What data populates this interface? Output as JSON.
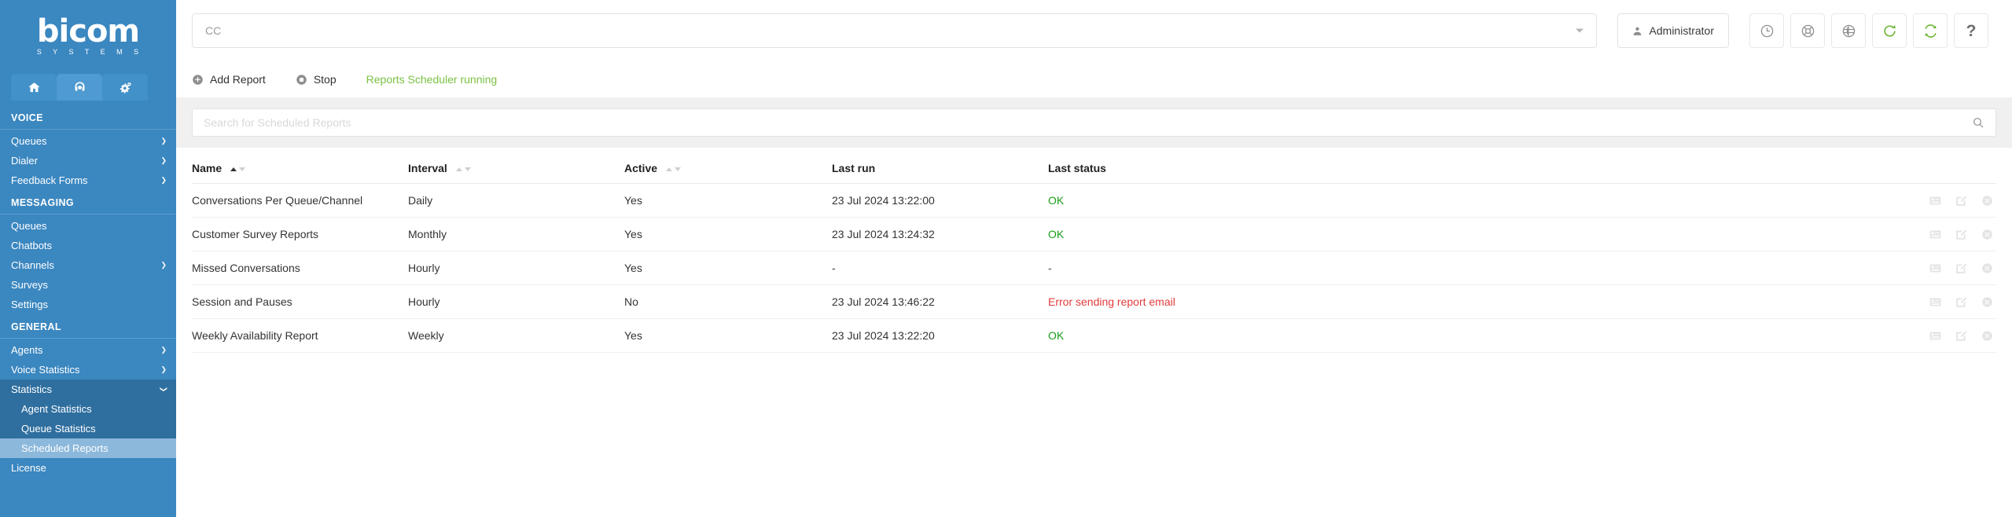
{
  "brand": {
    "name": "bicom",
    "tagline": "S Y S T E M S"
  },
  "tabs": [
    {
      "name": "home-tab",
      "icon": "home-icon",
      "active": false
    },
    {
      "name": "contact-center-tab",
      "icon": "headset-icon",
      "active": true
    },
    {
      "name": "settings-tab",
      "icon": "gears-icon",
      "active": false
    }
  ],
  "sidebar": {
    "sections": [
      {
        "title": "VOICE",
        "items": [
          {
            "label": "Queues",
            "chevron": "right"
          },
          {
            "label": "Dialer",
            "chevron": "right"
          },
          {
            "label": "Feedback Forms",
            "chevron": "right"
          }
        ]
      },
      {
        "title": "MESSAGING",
        "items": [
          {
            "label": "Queues",
            "chevron": ""
          },
          {
            "label": "Chatbots",
            "chevron": ""
          },
          {
            "label": "Channels",
            "chevron": "right"
          },
          {
            "label": "Surveys",
            "chevron": ""
          },
          {
            "label": "Settings",
            "chevron": ""
          }
        ]
      },
      {
        "title": "GENERAL",
        "items": [
          {
            "label": "Agents",
            "chevron": "right"
          },
          {
            "label": "Voice Statistics",
            "chevron": "right"
          },
          {
            "label": "Statistics",
            "chevron": "down",
            "expanded": true
          },
          {
            "label": "Agent Statistics",
            "sub": true
          },
          {
            "label": "Queue Statistics",
            "sub": true
          },
          {
            "label": "Scheduled Reports",
            "sub": true,
            "selected": true
          },
          {
            "label": "License",
            "chevron": ""
          }
        ]
      }
    ]
  },
  "topbar": {
    "tenant_select_value": "CC",
    "user_label": "Administrator",
    "icon_buttons": [
      {
        "name": "clock-icon",
        "color": "#8e8e8e"
      },
      {
        "name": "lifebuoy-icon",
        "color": "#8e8e8e"
      },
      {
        "name": "globe-icon",
        "color": "#8e8e8e"
      },
      {
        "name": "refresh-icon",
        "color": "#6ab42f"
      },
      {
        "name": "sync-icon",
        "color": "#6ab42f"
      },
      {
        "name": "help-icon",
        "color": "#6e6e6e",
        "glyph": "?"
      }
    ]
  },
  "actionbar": {
    "add_report_label": "Add Report",
    "stop_label": "Stop",
    "scheduler_status": "Reports Scheduler running",
    "scheduler_status_color": "#7ac143"
  },
  "search": {
    "placeholder": "Search for Scheduled Reports",
    "value": ""
  },
  "table": {
    "columns": [
      {
        "label": "Name",
        "sortable": true,
        "sort": "asc"
      },
      {
        "label": "Interval",
        "sortable": true,
        "sort": "none"
      },
      {
        "label": "Active",
        "sortable": true,
        "sort": "none"
      },
      {
        "label": "Last run",
        "sortable": false
      },
      {
        "label": "Last status",
        "sortable": false
      }
    ],
    "rows": [
      {
        "name": "Conversations Per Queue/Channel",
        "interval": "Daily",
        "active": "Yes",
        "last_run": "23 Jul 2024 13:22:00",
        "last_status": "OK",
        "status_type": "ok"
      },
      {
        "name": "Customer Survey Reports",
        "interval": "Monthly",
        "active": "Yes",
        "last_run": "23 Jul 2024 13:24:32",
        "last_status": "OK",
        "status_type": "ok"
      },
      {
        "name": "Missed Conversations",
        "interval": "Hourly",
        "active": "Yes",
        "last_run": "-",
        "last_status": "-",
        "status_type": "none"
      },
      {
        "name": "Session and Pauses",
        "interval": "Hourly",
        "active": "No",
        "last_run": "23 Jul 2024 13:46:22",
        "last_status": "Error sending report email",
        "status_type": "error"
      },
      {
        "name": "Weekly Availability Report",
        "interval": "Weekly",
        "active": "Yes",
        "last_run": "23 Jul 2024 13:22:20",
        "last_status": "OK",
        "status_type": "ok"
      }
    ],
    "row_actions": [
      {
        "name": "details-icon"
      },
      {
        "name": "edit-icon"
      },
      {
        "name": "delete-icon"
      }
    ]
  },
  "colors": {
    "sidebar_bg": "#3b87c0",
    "sidebar_expanded": "#2f6f9f",
    "sidebar_selected": "#8cb8db",
    "status_ok": "#1a9e1a",
    "status_error": "#e23b3b",
    "accent_green": "#7ac143"
  }
}
